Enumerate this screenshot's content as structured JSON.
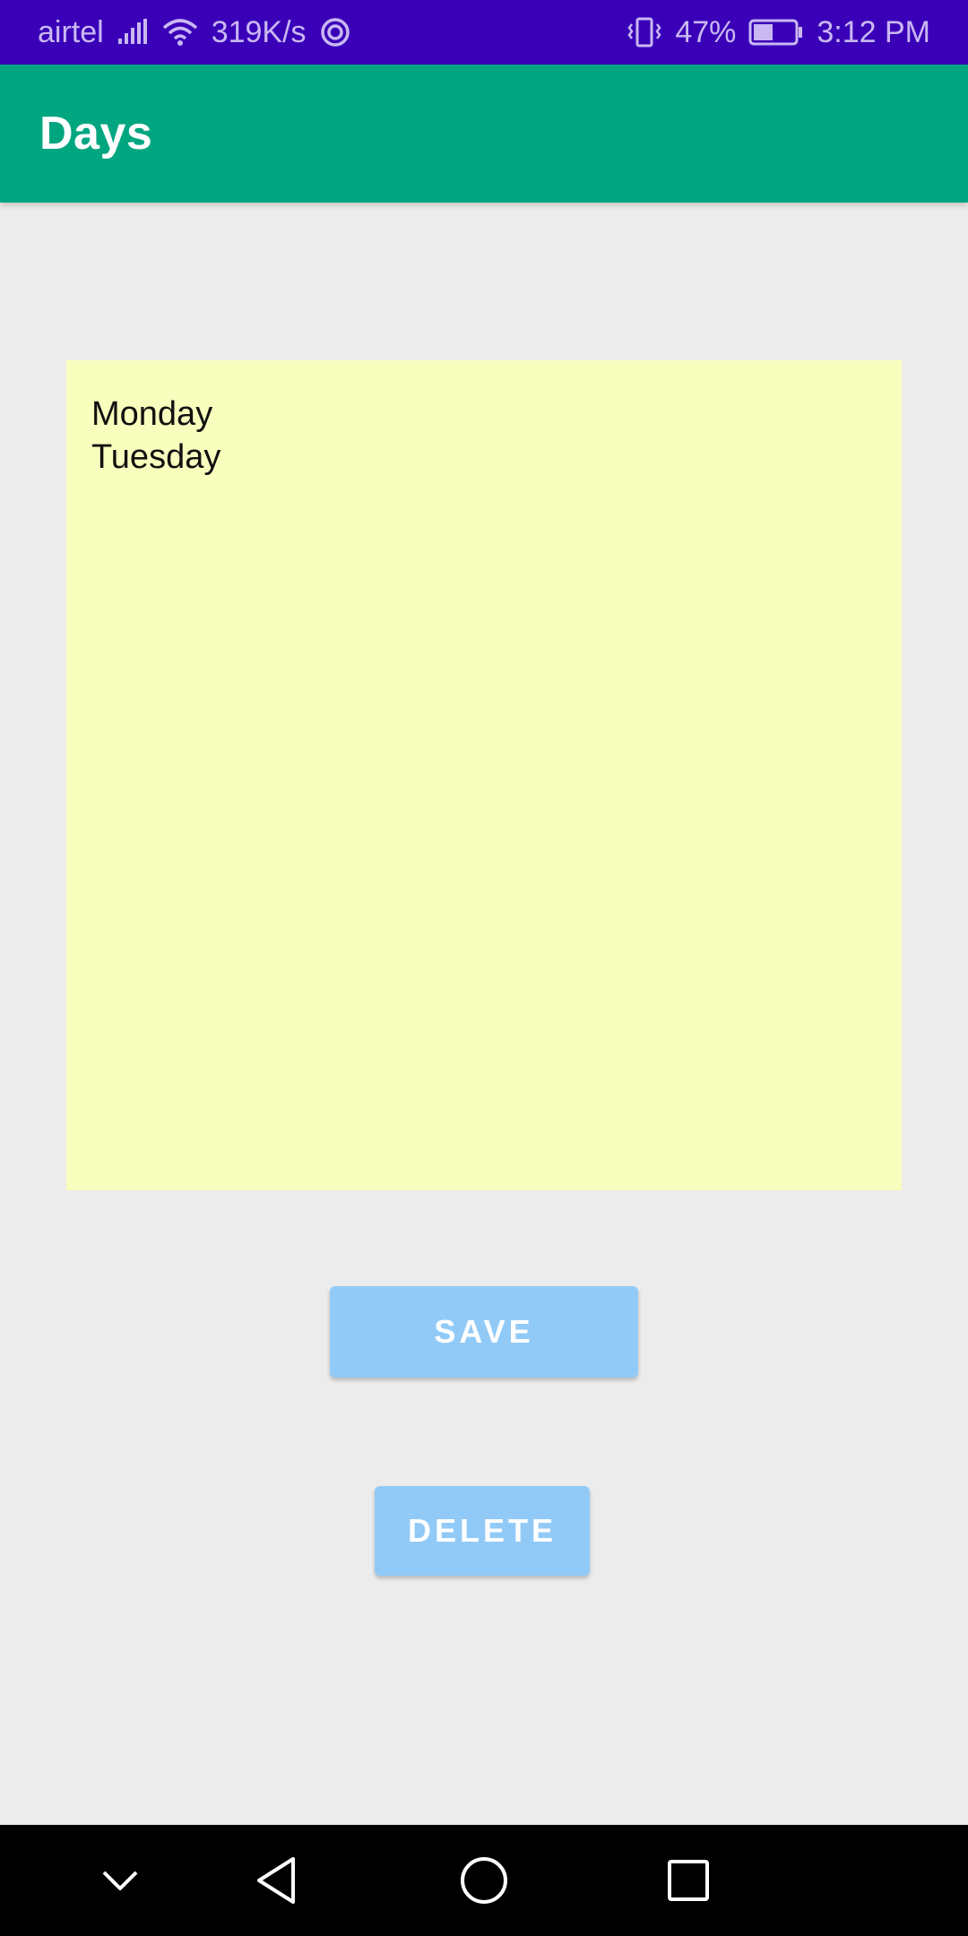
{
  "status_bar": {
    "carrier": "airtel",
    "speed": "319K/s",
    "battery": "47%",
    "time": "3:12 PM",
    "icons": [
      "signal-icon",
      "wifi-icon",
      "sync-app-icon",
      "vibrate-icon",
      "battery-icon"
    ],
    "battery_level": 0.47
  },
  "app_bar": {
    "title": "Days"
  },
  "note": {
    "text": "Monday\nTuesday"
  },
  "buttons": {
    "save_label": "SAVE",
    "delete_label": "DELETE"
  },
  "nav_bar": {
    "icons": [
      "collapse-icon",
      "back-icon",
      "home-icon",
      "recents-icon"
    ]
  },
  "colors": {
    "status_bar": "#3a00b8",
    "app_bar": "#00a680",
    "note_background": "#f8ffbe",
    "button": "#92caf7",
    "page_background": "#ececec"
  }
}
